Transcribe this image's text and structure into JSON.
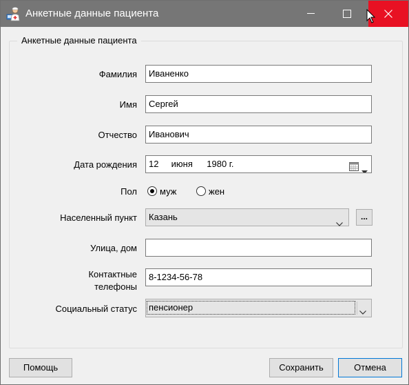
{
  "window": {
    "title": "Анкетные данные пациента",
    "close_color": "#e81123",
    "titlebar_color": "#767676"
  },
  "icons": {
    "app": "doctor-icon",
    "minimize": "minimize-icon",
    "maximize": "maximize-icon",
    "close": "close-icon",
    "calendar": "calendar-icon",
    "dropdown": "chevron-down-icon"
  },
  "form": {
    "group_title": "Анкетные данные пациента",
    "surname": {
      "label": "Фамилия",
      "value": "Иваненко"
    },
    "name": {
      "label": "Имя",
      "value": "Сергей"
    },
    "patronymic": {
      "label": "Отчество",
      "value": "Иванович"
    },
    "birthdate": {
      "label": "Дата рождения",
      "day": "12",
      "month": "июня",
      "year": "1980 г."
    },
    "gender": {
      "label": "Пол",
      "options": [
        "муж",
        "жен"
      ],
      "selected": "муж"
    },
    "locality": {
      "label": "Населенный пункт",
      "value": "Казань",
      "browse_label": "..."
    },
    "street": {
      "label": "Улица, дом",
      "value": ""
    },
    "phones": {
      "label_line1": "Контактные",
      "label_line2": "телефоны",
      "value": "8-1234-56-78"
    },
    "social_status": {
      "label": "Социальный статус",
      "value": "пенсионер"
    }
  },
  "buttons": {
    "help": "Помощь",
    "save": "Сохранить",
    "cancel": "Отмена"
  }
}
